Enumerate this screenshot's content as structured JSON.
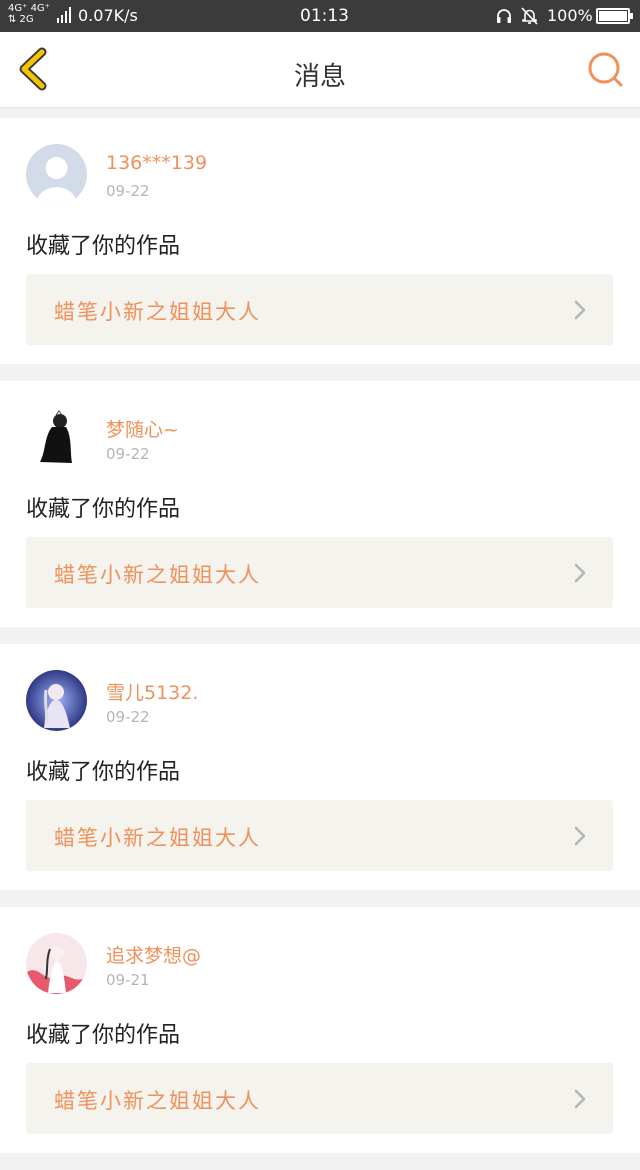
{
  "status_bar": {
    "network_top": "4G⁺ 4G⁺",
    "network_bottom": "⇅ 2G",
    "speed": "0.07K/s",
    "time": "01:13",
    "battery": "100%",
    "icons": [
      "signal-icon",
      "headset-icon",
      "bell-muted-icon",
      "battery-icon"
    ]
  },
  "header": {
    "title": "消息",
    "back_icon": "chevron-left-icon",
    "search_icon": "search-icon"
  },
  "colors": {
    "accent": "#f0915a",
    "back": "#f5c400",
    "card_bg": "#ffffff",
    "link_bg": "#f4f3ee"
  },
  "messages": [
    {
      "user": "136***139",
      "date": "09-22",
      "action": "收藏了你的作品",
      "work": "蜡笔小新之姐姐大人",
      "avatar": "default-avatar"
    },
    {
      "user": "梦随心~",
      "date": "09-22",
      "action": "收藏了你的作品",
      "work": "蜡笔小新之姐姐大人",
      "avatar": "silhouette-avatar"
    },
    {
      "user": "雪儿5132.",
      "date": "09-22",
      "action": "收藏了你的作品",
      "work": "蜡笔小新之姐姐大人",
      "avatar": "anime-avatar"
    },
    {
      "user": "追求梦想@",
      "date": "09-21",
      "action": "收藏了你的作品",
      "work": "蜡笔小新之姐姐大人",
      "avatar": "anime-pink-avatar"
    }
  ]
}
